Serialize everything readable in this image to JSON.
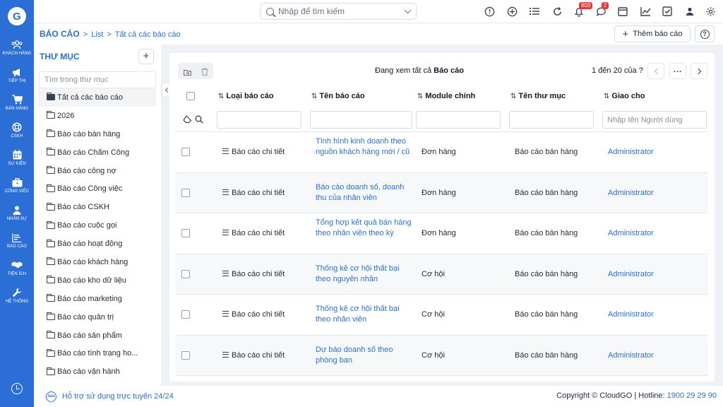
{
  "rail": {
    "items": [
      {
        "label": "KHÁCH HÀNG",
        "icon": "customers-icon"
      },
      {
        "label": "TIẾP THỊ",
        "icon": "megaphone-icon"
      },
      {
        "label": "BÁN HÀNG",
        "icon": "cart-icon"
      },
      {
        "label": "CSKH",
        "icon": "lifebuoy-icon"
      },
      {
        "label": "SỰ KIỆN",
        "icon": "calendar-icon"
      },
      {
        "label": "CÔNG VIỆC",
        "icon": "briefcase-icon"
      },
      {
        "label": "NHÂN SỰ",
        "icon": "person-icon"
      },
      {
        "label": "BÁO CÁO",
        "icon": "report-icon"
      },
      {
        "label": "TIỆN ÍCH",
        "icon": "handshake-icon"
      },
      {
        "label": "HỆ THỐNG",
        "icon": "wrench-icon"
      }
    ]
  },
  "topbar": {
    "search_placeholder": "Nhập để tìm kiếm",
    "notification_count": "603",
    "message_count": "2"
  },
  "breadcrumb": {
    "module": "BÁO CÁO",
    "list": "List",
    "current": "Tất cả các báo cáo"
  },
  "actions": {
    "add_report": "Thêm báo cáo"
  },
  "folders": {
    "title": "THƯ MỤC",
    "search_placeholder": "Tìm trong thư mục",
    "items": [
      "Tất cả các báo cáo",
      "2026",
      "Báo cáo bán hàng",
      "Báo cáo Chấm Công",
      "Báo cáo công nợ",
      "Báo cáo Công việc",
      "Báo cáo CSKH",
      "Báo cáo cuộc gọi",
      "Báo cáo hoạt động",
      "Báo cáo khách hàng",
      "Báo cáo kho dữ liệu",
      "Báo cáo marketing",
      "Báo cáo quản trị",
      "Báo cáo sản phẩm",
      "Báo cáo tình trạng ho...",
      "Báo cáo vận hành"
    ]
  },
  "listview": {
    "viewing_prefix": "Đang xem tất cả",
    "viewing_module": "Báo cáo",
    "paging": "1 đến 20 của",
    "paging_help": "?",
    "columns": [
      "Loại báo cáo",
      "Tên báo cáo",
      "Module chính",
      "Tên thư mục",
      "Giao cho"
    ],
    "assignee_placeholder": "Nhập tên Người dùng",
    "rows": [
      {
        "type": "Báo cáo chi tiết",
        "name": "Tình hình kinh doanh theo nguồn khách hàng mới / cũ",
        "module": "Đơn hàng",
        "folder": "Báo cáo bán hàng",
        "assignee": "Administrator"
      },
      {
        "type": "Báo cáo chi tiết",
        "name": "Báo cáo doanh số, doanh thu của nhân viên",
        "module": "Đơn hàng",
        "folder": "Báo cáo bán hàng",
        "assignee": "Administrator"
      },
      {
        "type": "Báo cáo chi tiết",
        "name": "Tổng hợp kết quả bán hàng theo nhân viên theo kỳ",
        "module": "Đơn hàng",
        "folder": "Báo cáo bán hàng",
        "assignee": "Administrator"
      },
      {
        "type": "Báo cáo chi tiết",
        "name": "Thống kê cơ hội thất bại theo nguyên nhân",
        "module": "Cơ hội",
        "folder": "Báo cáo bán hàng",
        "assignee": "Administrator"
      },
      {
        "type": "Báo cáo chi tiết",
        "name": "Thống kê cơ hội thất bại theo nhân viên",
        "module": "Cơ hội",
        "folder": "Báo cáo bán hàng",
        "assignee": "Administrator"
      },
      {
        "type": "Báo cáo chi tiết",
        "name": "Dự báo doanh số theo phòng ban",
        "module": "Cơ hội",
        "folder": "Báo cáo bán hàng",
        "assignee": "Administrator"
      }
    ]
  },
  "footer": {
    "zalo": "Zalo",
    "support": "Hỗ trợ sử dụng trực tuyến 24/24",
    "copyright": "Copyright © CloudGO",
    "hotline_label": "Hotline:",
    "hotline": "1900 29 29 90"
  },
  "colors": {
    "brand": "#2b6fd6",
    "badge": "#e53935"
  }
}
